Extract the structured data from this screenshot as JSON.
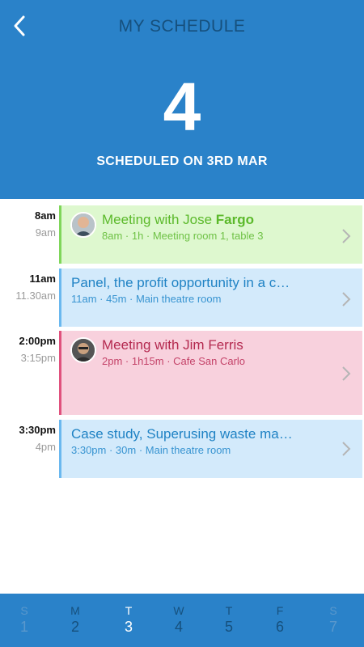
{
  "header": {
    "title": "MY SCHEDULE",
    "count": "4",
    "subtitle": "SCHEDULED ON 3RD MAR",
    "back_icon": "chevron-left-icon"
  },
  "events": [
    {
      "start": "8am",
      "end": "9am",
      "title_main": "Meeting with Jose ",
      "title_strong": "Fargo",
      "meta": "8am · 1h · Meeting room 1, table 3",
      "color": "green",
      "has_avatar": true
    },
    {
      "start": "11am",
      "end": "11.30am",
      "title": "Panel, the profit opportunity in a c…",
      "meta": "11am · 45m · Main theatre room",
      "color": "blue",
      "has_avatar": false
    },
    {
      "start": "2:00pm",
      "end": "3:15pm",
      "title": "Meeting with Jim Ferris",
      "meta": "2pm · 1h15m · Cafe San Carlo",
      "color": "pink",
      "has_avatar": true
    },
    {
      "start": "3:30pm",
      "end": "4pm",
      "title": "Case study, Superusing waste ma…",
      "meta": "3:30pm · 30m · Main theatre room",
      "color": "blue",
      "has_avatar": false
    }
  ],
  "week": [
    {
      "letter": "S",
      "num": "1"
    },
    {
      "letter": "M",
      "num": "2"
    },
    {
      "letter": "T",
      "num": "3"
    },
    {
      "letter": "W",
      "num": "4"
    },
    {
      "letter": "T",
      "num": "5"
    },
    {
      "letter": "F",
      "num": "6"
    },
    {
      "letter": "S",
      "num": "7"
    }
  ],
  "colors": {
    "header_bg": "#2a82c9",
    "green": "#7fd65a",
    "blue": "#6ab8ef",
    "pink": "#e0517d"
  }
}
